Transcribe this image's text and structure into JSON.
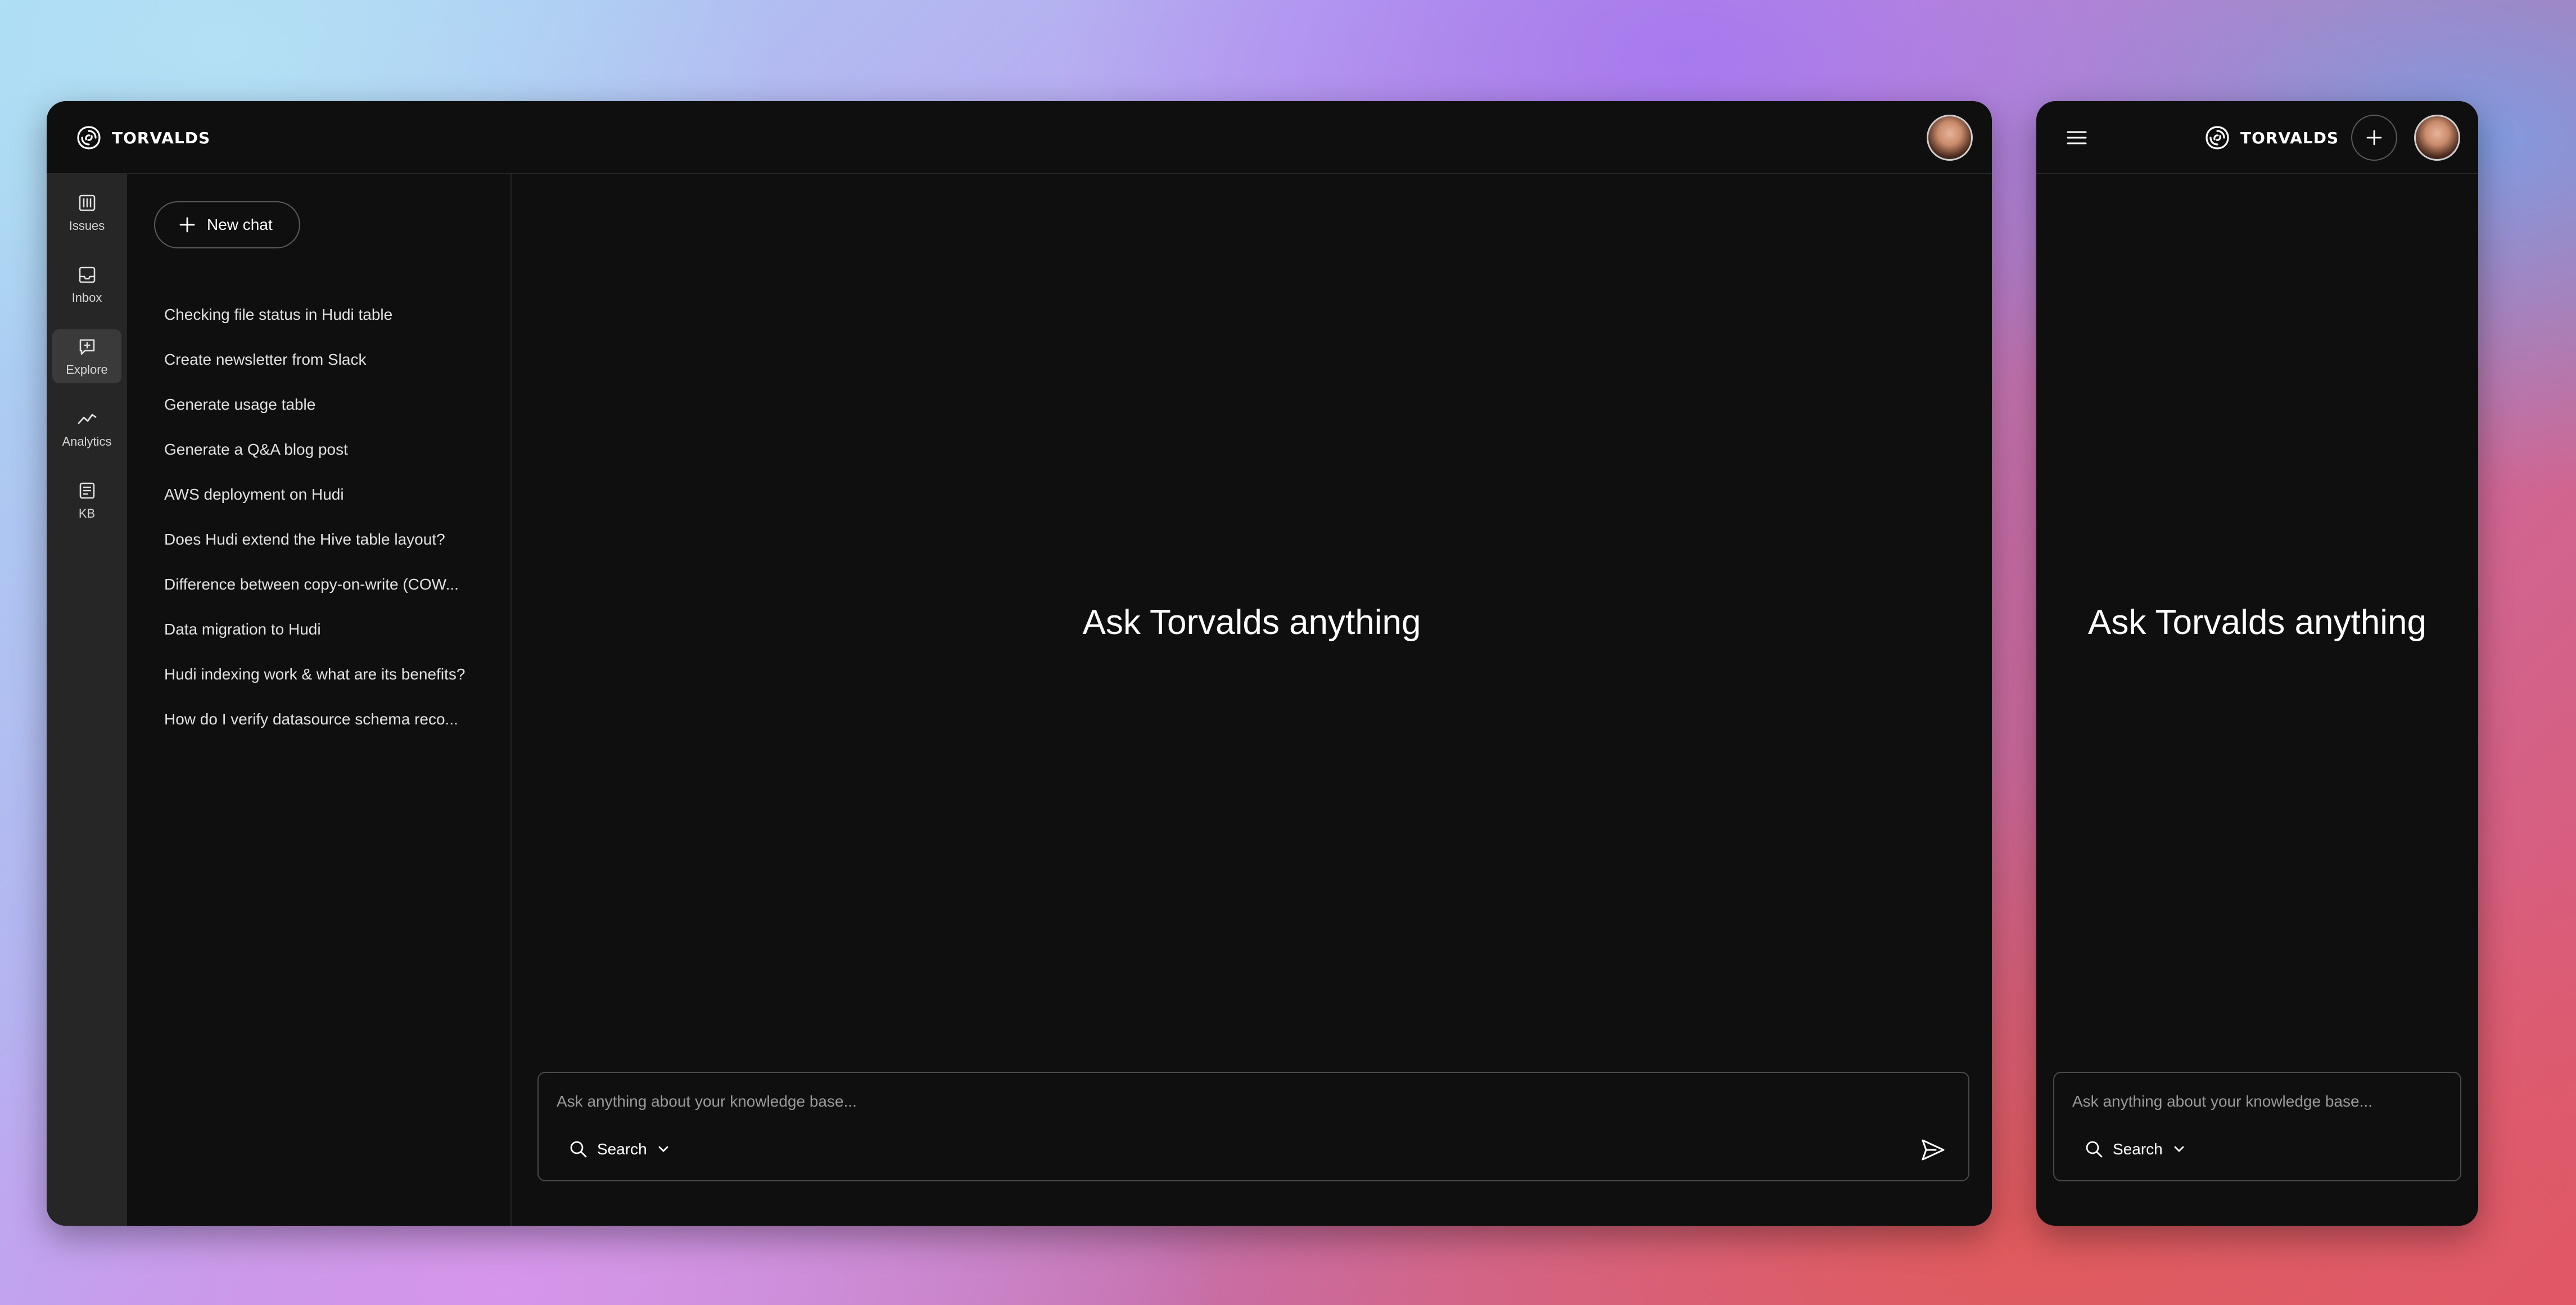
{
  "brand": {
    "name": "TORVALDS"
  },
  "nav": {
    "items": [
      {
        "label": "Issues",
        "icon": "issues-icon"
      },
      {
        "label": "Inbox",
        "icon": "inbox-icon"
      },
      {
        "label": "Explore",
        "icon": "explore-icon",
        "active": true
      },
      {
        "label": "Analytics",
        "icon": "analytics-icon"
      },
      {
        "label": "KB",
        "icon": "kb-icon"
      }
    ]
  },
  "history": {
    "new_chat_label": "New chat",
    "chats": [
      "Checking file status in Hudi table",
      "Create newsletter from Slack",
      "Generate usage table",
      "Generate a Q&A blog post",
      "AWS deployment on Hudi",
      "Does Hudi extend the Hive table layout?",
      "Difference between copy-on-write (COW...",
      "Data migration to Hudi",
      "Hudi indexing work & what are its benefits?",
      "How do I verify datasource schema reco..."
    ]
  },
  "main": {
    "hero": "Ask Torvalds anything",
    "composer": {
      "placeholder": "Ask anything about your knowledge base...",
      "value": "",
      "mode_label": "Search"
    }
  },
  "mobile": {
    "hero": "Ask Torvalds anything",
    "composer": {
      "placeholder": "Ask anything about your knowledge base...",
      "mode_label": "Search"
    }
  },
  "colors": {
    "window_bg": "#0f0f0f",
    "rail_bg": "#262626",
    "text": "#ffffff",
    "muted": "#9a9a9a"
  }
}
